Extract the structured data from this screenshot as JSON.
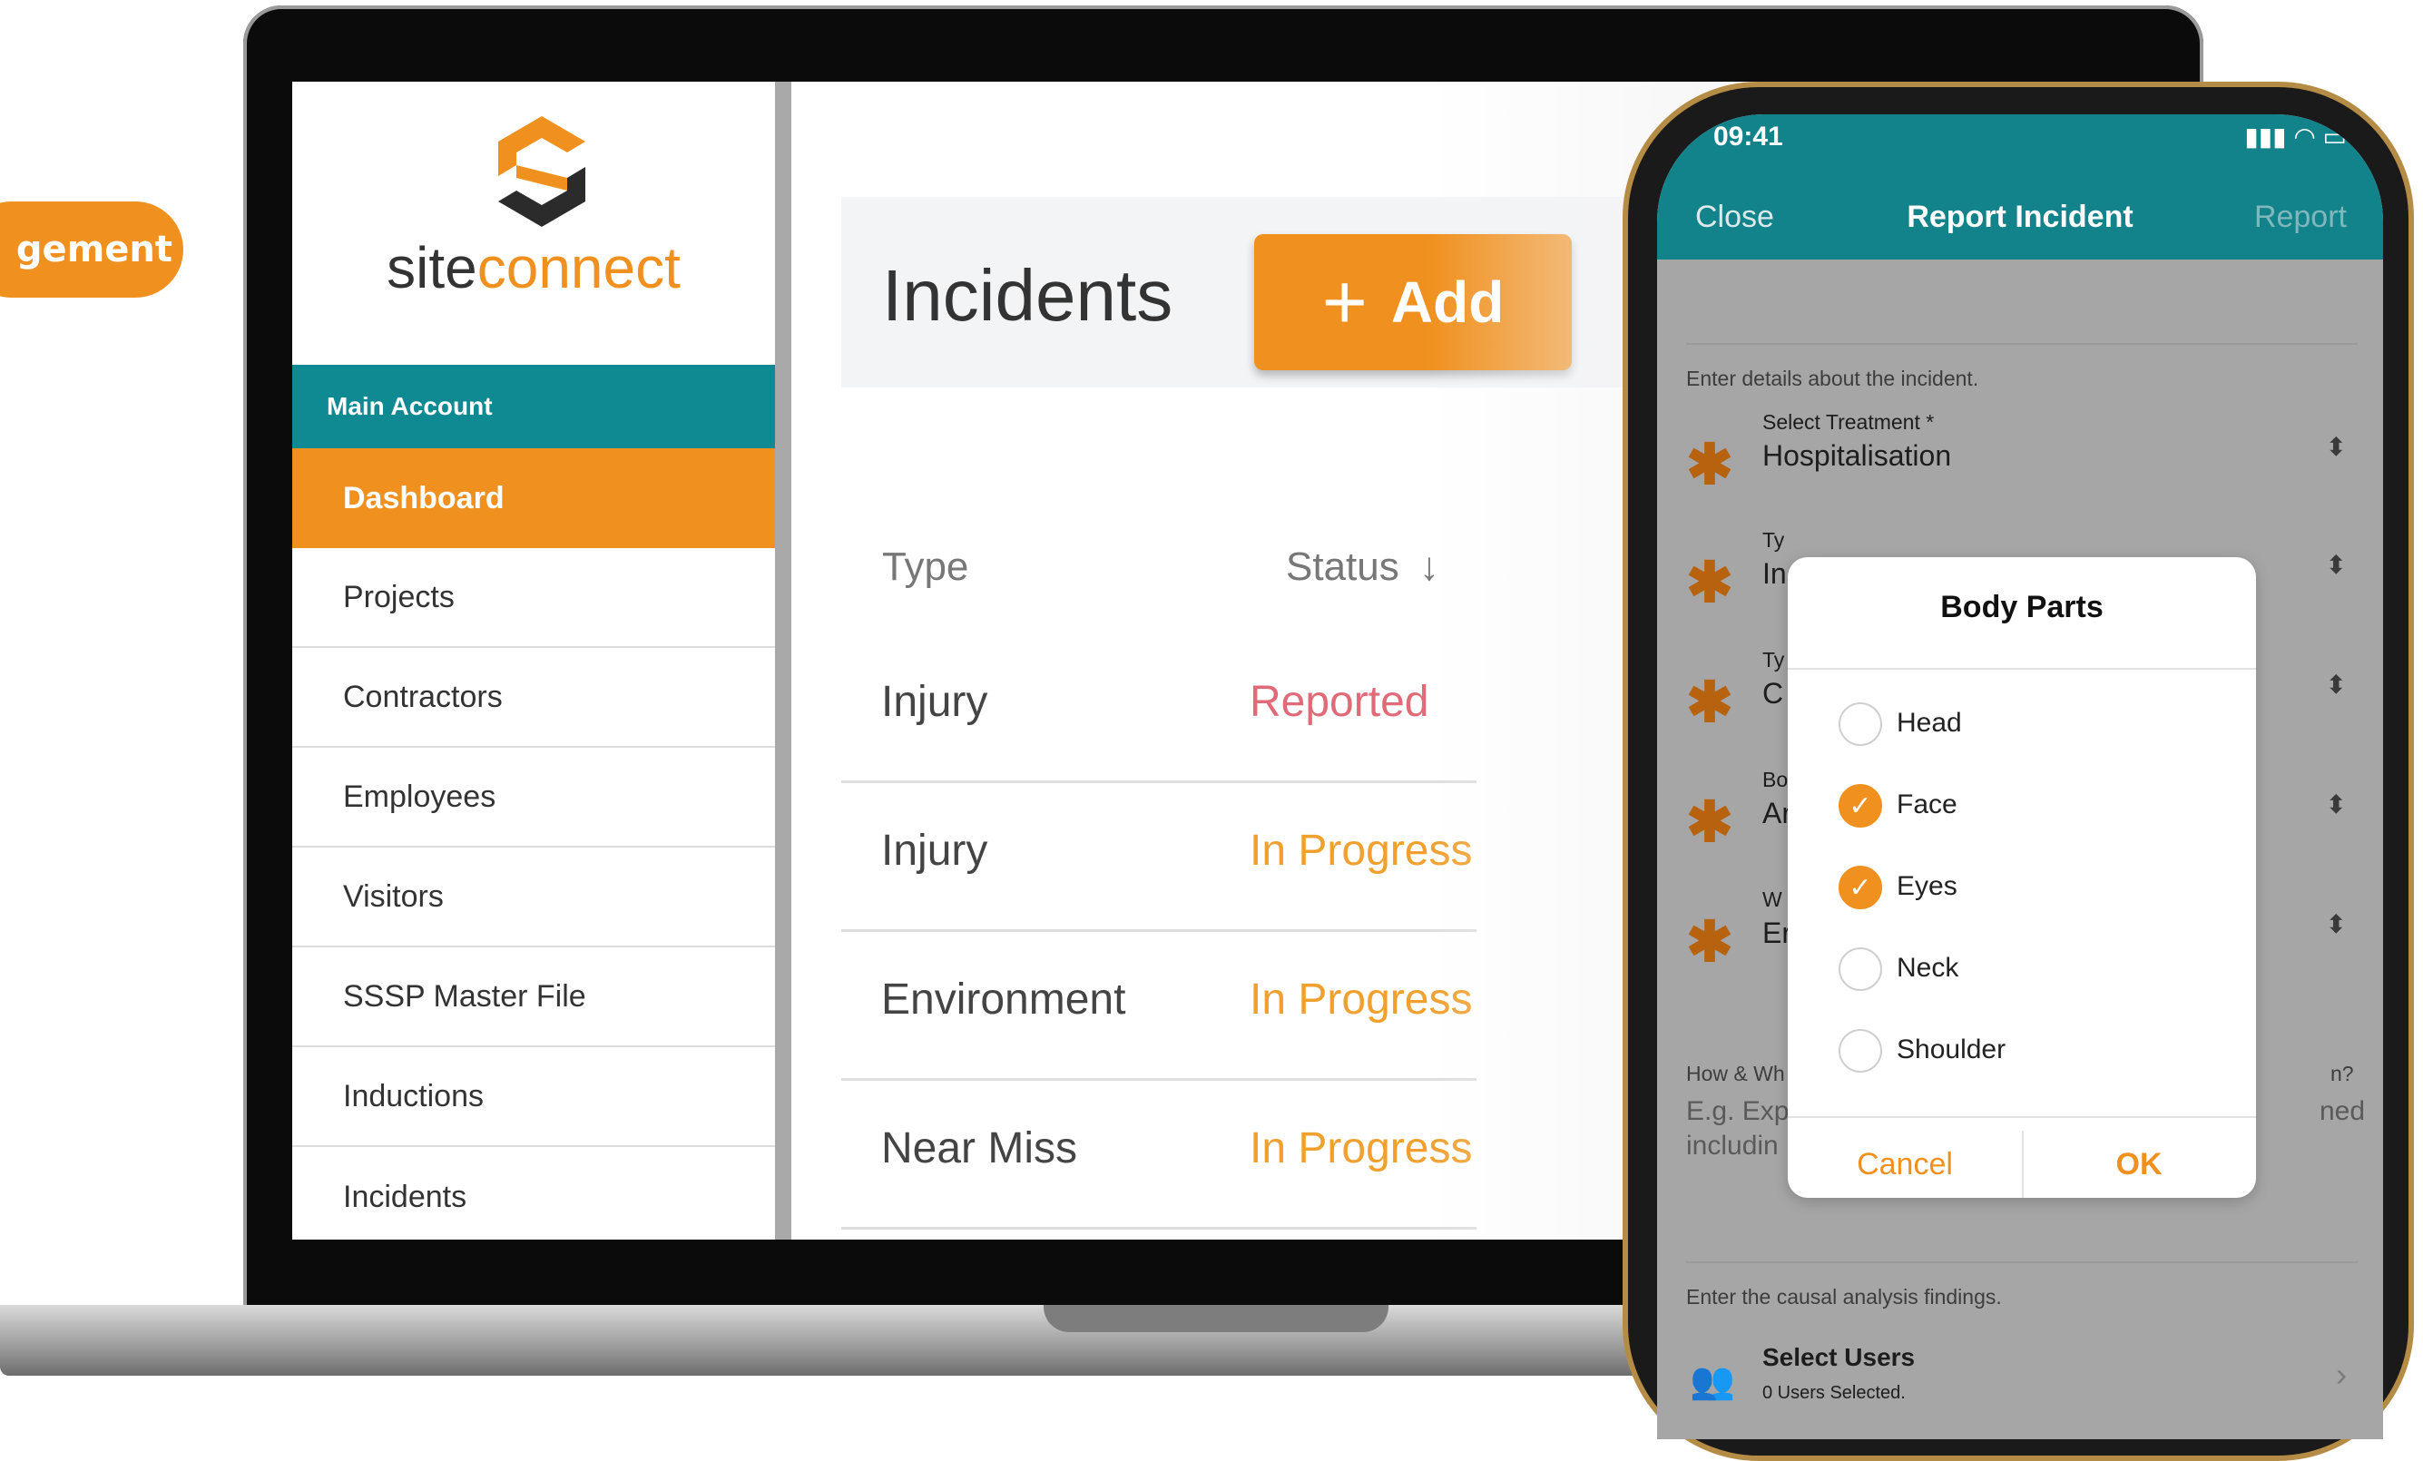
{
  "badge": {
    "label": "gement"
  },
  "laptop": {
    "brand": {
      "part1": "site",
      "part2": "connect"
    },
    "sidebar": {
      "account": "Main Account",
      "items": [
        {
          "label": "Dashboard",
          "active": true
        },
        {
          "label": "Projects"
        },
        {
          "label": "Contractors"
        },
        {
          "label": "Employees"
        },
        {
          "label": "Visitors"
        },
        {
          "label": "SSSP Master File"
        },
        {
          "label": "Inductions"
        },
        {
          "label": "Incidents"
        }
      ]
    },
    "main": {
      "title": "Incidents",
      "add_label": "Add",
      "columns": {
        "type": "Type",
        "status": "Status"
      },
      "rows": [
        {
          "type": "Injury",
          "status": "Reported"
        },
        {
          "type": "Injury",
          "status": "In Progress"
        },
        {
          "type": "Environment",
          "status": "In Progress"
        },
        {
          "type": "Near Miss",
          "status": "In Progress"
        }
      ]
    }
  },
  "phone": {
    "time": "09:41",
    "nav": {
      "close": "Close",
      "title": "Report Incident",
      "report": "Report"
    },
    "section_details": "Enter details about the incident.",
    "fields": [
      {
        "label": "Select Treatment *",
        "value": "Hospitalisation"
      },
      {
        "label": "Ty",
        "value": "In"
      },
      {
        "label": "Ty",
        "value": "C"
      },
      {
        "label": "Bo",
        "value": "Ar"
      },
      {
        "label": "W",
        "value": "Er"
      }
    ],
    "how_label_left": "How & Wh",
    "how_label_right": "n?",
    "how_placeholder_l1": "E.g. Exp",
    "how_placeholder_l1_right": "ned",
    "how_placeholder_l2": "includin",
    "section_causal": "Enter the causal analysis findings.",
    "users": {
      "title": "Select Users",
      "sub": "0 Users Selected."
    },
    "dialog": {
      "title": "Body Parts",
      "options": [
        {
          "label": "Head",
          "checked": false
        },
        {
          "label": "Face",
          "checked": true
        },
        {
          "label": "Eyes",
          "checked": true
        },
        {
          "label": "Neck",
          "checked": false
        },
        {
          "label": "Shoulder",
          "checked": false
        }
      ],
      "cancel": "Cancel",
      "ok": "OK"
    }
  },
  "colors": {
    "accent": "#f0901e",
    "teal": "#0f8a93",
    "reported": "#e06a78",
    "progress": "#f0a02e"
  }
}
